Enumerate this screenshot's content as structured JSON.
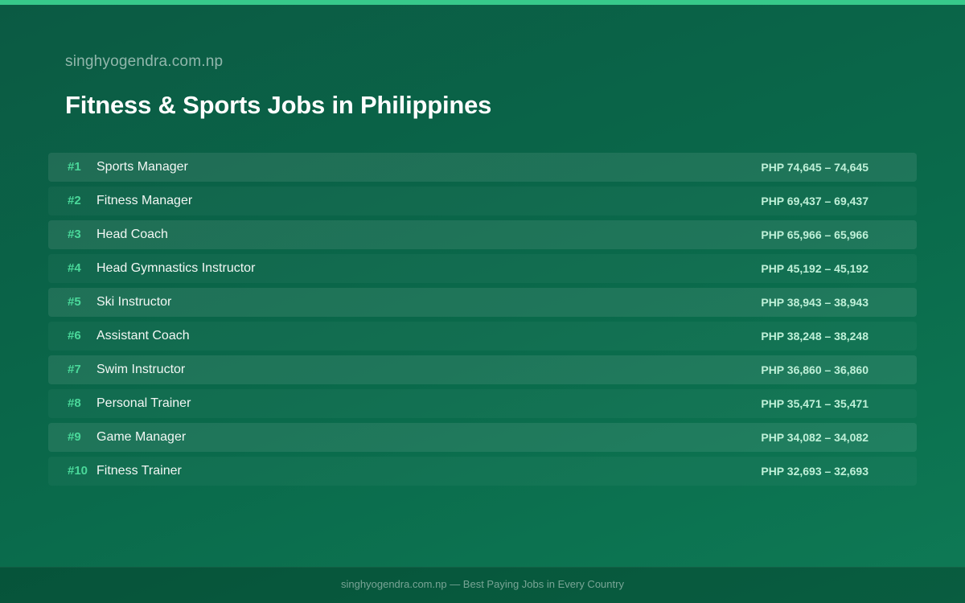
{
  "header": {
    "site_name": "singhyogendra.com.np",
    "title": "Fitness & Sports Jobs in Philippines"
  },
  "jobs": [
    {
      "rank": "#1",
      "title": "Sports Manager",
      "salary": "PHP 74,645 – 74,645"
    },
    {
      "rank": "#2",
      "title": "Fitness Manager",
      "salary": "PHP 69,437 – 69,437"
    },
    {
      "rank": "#3",
      "title": "Head Coach",
      "salary": "PHP 65,966 – 65,966"
    },
    {
      "rank": "#4",
      "title": "Head Gymnastics Instructor",
      "salary": "PHP 45,192 – 45,192"
    },
    {
      "rank": "#5",
      "title": "Ski Instructor",
      "salary": "PHP 38,943 – 38,943"
    },
    {
      "rank": "#6",
      "title": "Assistant Coach",
      "salary": "PHP 38,248 – 38,248"
    },
    {
      "rank": "#7",
      "title": "Swim Instructor",
      "salary": "PHP 36,860 – 36,860"
    },
    {
      "rank": "#8",
      "title": "Personal Trainer",
      "salary": "PHP 35,471 – 35,471"
    },
    {
      "rank": "#9",
      "title": "Game Manager",
      "salary": "PHP 34,082 – 34,082"
    },
    {
      "rank": "#10",
      "title": "Fitness Trainer",
      "salary": "PHP 32,693 – 32,693"
    }
  ],
  "footer": {
    "text": "singhyogendra.com.np — Best Paying Jobs in Every Country"
  },
  "colors": {
    "background": "#0a6a4b",
    "accent": "#37c98a",
    "rank": "#4ad89a",
    "salary": "#bff0d8"
  }
}
